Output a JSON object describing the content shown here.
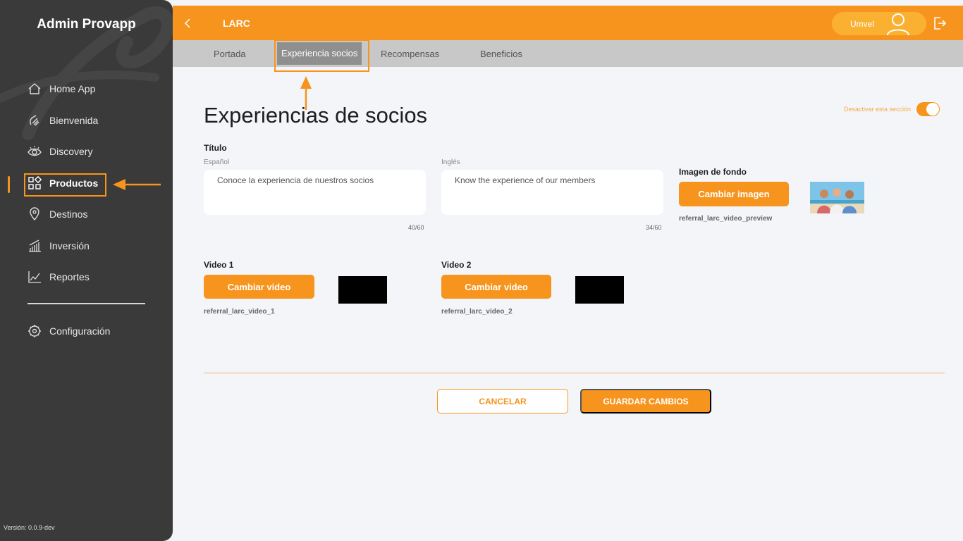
{
  "sidebar": {
    "brand": "Admin Provapp",
    "items": [
      {
        "label": "Home App",
        "icon": "home-icon"
      },
      {
        "label": "Bienvenida",
        "icon": "wave-hand-icon"
      },
      {
        "label": "Discovery",
        "icon": "eye-icon"
      },
      {
        "label": "Productos",
        "icon": "grid-icon"
      },
      {
        "label": "Destinos",
        "icon": "location-pin-icon"
      },
      {
        "label": "Inversión",
        "icon": "bar-chart-icon"
      },
      {
        "label": "Reportes",
        "icon": "line-chart-icon"
      },
      {
        "label": "Configuración",
        "icon": "gear-icon"
      }
    ],
    "active": "Productos",
    "version": "Versión: 0.0.9-dev"
  },
  "topbar": {
    "title": "LARC",
    "user_name": "Umvel"
  },
  "tabs": [
    {
      "label": "Portada"
    },
    {
      "label": "Experiencia socios"
    },
    {
      "label": "Recompensas"
    },
    {
      "label": "Beneficios"
    }
  ],
  "active_tab": "Experiencia socios",
  "main": {
    "page_title": "Experiencias de socios",
    "toggle_label": "Desactivar esta sección",
    "toggle_on": true,
    "title_section": {
      "label": "Título",
      "spanish_label": "Español",
      "spanish_value": "Conoce la experiencia de nuestros socios",
      "spanish_counter": "40/60",
      "english_label": "Inglés",
      "english_value": "Know the experience of our members",
      "english_counter": "34/60"
    },
    "background": {
      "label": "Imagen de fondo",
      "button": "Cambiar imagen",
      "file": "referral_larc_video_preview"
    },
    "video1": {
      "label": "Video 1",
      "button": "Cambiar video",
      "file": "referral_larc_video_1"
    },
    "video2": {
      "label": "Video 2",
      "button": "Cambiar video",
      "file": "referral_larc_video_2"
    },
    "cancel": "CANCELAR",
    "save": "GUARDAR CAMBIOS"
  },
  "colors": {
    "accent": "#f7941d",
    "sidebar": "#3a3a3a",
    "tabbar": "#c8c8c8"
  }
}
